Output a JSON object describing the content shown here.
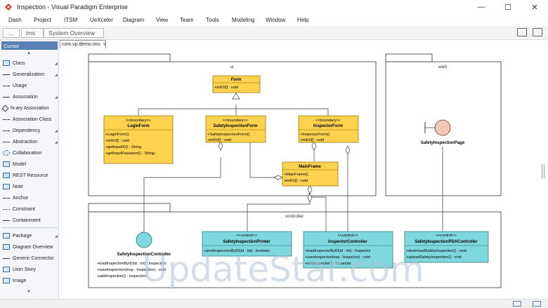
{
  "window": {
    "title": "Inspection - Visual Paradigm Enterprise"
  },
  "menu": [
    "Dash",
    "Project",
    "ITSM",
    "UeXceler",
    "Diagram",
    "View",
    "Team",
    "Tools",
    "Modeling",
    "Window",
    "Help"
  ],
  "breadcrumb": [
    "...",
    "ims",
    "System Overview"
  ],
  "palette": {
    "cursor": "Cursor",
    "items": [
      "Class",
      "Generalization",
      "Usage",
      "Association",
      "N-ary Association",
      "Association Class",
      "Dependency",
      "Abstraction",
      "Collaboration",
      "Model",
      "REST Resource",
      "Note",
      "Anchor",
      "Constraint",
      "Containment",
      "Package",
      "Diagram Overview",
      "Generic Connector",
      "User Story",
      "Image"
    ]
  },
  "diagram_tab": "com.vp.demo.ims",
  "diagram": {
    "packages": {
      "ui": "ui",
      "web": "web",
      "controller": "controller"
    },
    "form": {
      "name": "Form",
      "ops": [
        "+initUI() : void"
      ]
    },
    "login_form": {
      "stereo": "<<boundary>>",
      "name": "LoginForm",
      "ops": [
        "+LoginForm()",
        "+initUI() : void",
        "+getInputID() : String",
        "+getInputPassword() : String"
      ]
    },
    "safety_form": {
      "stereo": "<<boundary>>",
      "name": "SafetyInspectionForm",
      "ops": [
        "+SafetyInspectionForm()",
        "+initUI() : void"
      ]
    },
    "inspector_form": {
      "stereo": "<<boundary>>",
      "name": "InspectorForm",
      "ops": [
        "+InspectorForm()",
        "+initUI() : void"
      ]
    },
    "main_frame": {
      "name": "MainFrame",
      "ops": [
        "+MainFrame()",
        "+initUI() : void"
      ]
    },
    "safety_page": {
      "name": "SafetyInspectionPage"
    },
    "safety_controller": {
      "name": "SafetyInspectionController",
      "ops": [
        "+loadInspectionByID(id : int) : Inspection",
        "+saveInspection(insp : Inspection) : void",
        "+addInspection() : Inspection"
      ]
    },
    "printer": {
      "stereo": "<<control>>",
      "name": "SafetyInspectionPrinter",
      "ops": [
        "+printInspectionByID(id : int) : boolean"
      ]
    },
    "inspector_controller": {
      "stereo": "<<control>>",
      "name": "InspectorController",
      "ops": [
        "+loadInspectorByID(id : int) : Inspector",
        "+saveInspector(insp : Inspector) : void",
        "+addInspector() : Inspector"
      ]
    },
    "pda_controller": {
      "stereo": "<<control>>",
      "name": "SafetyInspectionPDAController",
      "ops": [
        "+downloadSafetyInspection() : void",
        "+uploadSafetyInspection() : void"
      ]
    }
  },
  "watermark": "UpdateStar.com",
  "colors": {
    "boundary_fill": "#fdd24e",
    "control_fill": "#7fd8dd",
    "palette_selected": "#5b7fb4",
    "entity_fill": "#f0c8b8"
  }
}
